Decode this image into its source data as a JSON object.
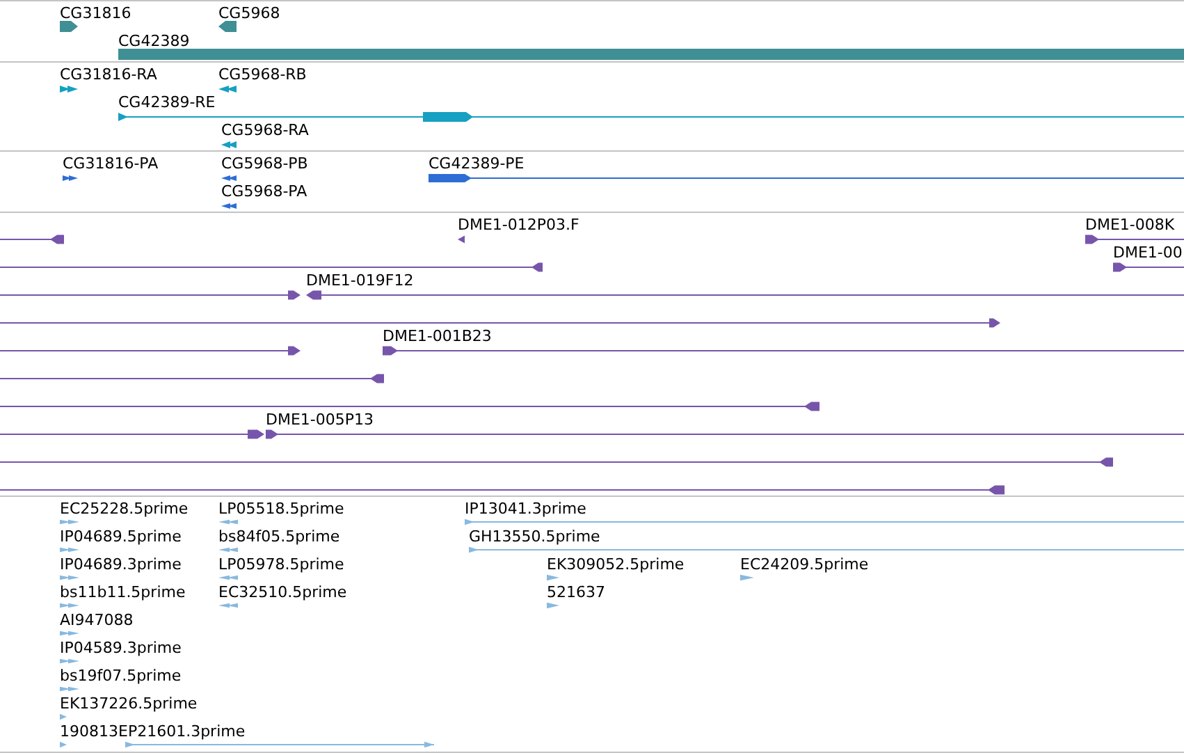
{
  "tracks": [
    {
      "kind": "gene",
      "color": "#3f8f94",
      "features": [
        {
          "label": "CG31816",
          "reverse": false
        },
        {
          "label": "CG5968",
          "reverse": true
        },
        {
          "label": "CG42389"
        }
      ]
    },
    {
      "kind": "transcript",
      "color": "#16a0c2",
      "features": [
        {
          "label": "CG31816-RA",
          "reverse": false
        },
        {
          "label": "CG5968-RB",
          "reverse": true
        },
        {
          "label": "CG42389-RE",
          "reverse": false
        },
        {
          "label": "CG5968-RA",
          "reverse": true
        }
      ]
    },
    {
      "kind": "protein",
      "color": "#2e6dd4",
      "features": [
        {
          "label": "CG31816-PA",
          "reverse": false
        },
        {
          "label": "CG5968-PB",
          "reverse": true
        },
        {
          "label": "CG42389-PE",
          "reverse": false
        },
        {
          "label": "CG5968-PA",
          "reverse": true
        }
      ]
    },
    {
      "kind": "clone",
      "color": "#7655ab",
      "features": [
        {
          "reverse": true
        },
        {
          "label": "DME1-012P03.F",
          "reverse": true
        },
        {
          "label": "DME1-008K",
          "reverse": false
        },
        {
          "reverse": true
        },
        {
          "label": "DME1-00",
          "reverse": false
        },
        {
          "reverse": false
        },
        {
          "label": "DME1-019F12",
          "reverse": true
        },
        {
          "reverse": false
        },
        {
          "reverse": false
        },
        {
          "label": "DME1-001B23",
          "reverse": false
        },
        {
          "reverse": true
        },
        {
          "reverse": true
        },
        {
          "reverse": false
        },
        {
          "label": "DME1-005P13",
          "reverse": false
        },
        {
          "reverse": true
        },
        {
          "reverse": true
        }
      ]
    },
    {
      "kind": "est",
      "color": "#88b9df",
      "features": [
        {
          "label": "EC25228.5prime",
          "reverse": false
        },
        {
          "label": "LP05518.5prime",
          "reverse": true
        },
        {
          "label": "IP13041.3prime",
          "reverse": false
        },
        {
          "label": "IP04689.5prime",
          "reverse": false
        },
        {
          "label": "bs84f05.5prime",
          "reverse": true
        },
        {
          "label": "GH13550.5prime",
          "reverse": false
        },
        {
          "label": "IP04689.3prime",
          "reverse": false
        },
        {
          "label": "LP05978.5prime",
          "reverse": true
        },
        {
          "label": "EK309052.5prime",
          "reverse": false
        },
        {
          "label": "EC24209.5prime",
          "reverse": false
        },
        {
          "label": "bs11b11.5prime",
          "reverse": false
        },
        {
          "label": "EC32510.5prime",
          "reverse": true
        },
        {
          "label": "521637",
          "reverse": false
        },
        {
          "label": "AI947088",
          "reverse": false
        },
        {
          "label": "IP04589.3prime",
          "reverse": false
        },
        {
          "label": "bs19f07.5prime",
          "reverse": false
        },
        {
          "label": "EK137226.5prime",
          "reverse": false
        },
        {
          "label": "190813EP21601.3prime",
          "reverse": false
        }
      ]
    }
  ]
}
